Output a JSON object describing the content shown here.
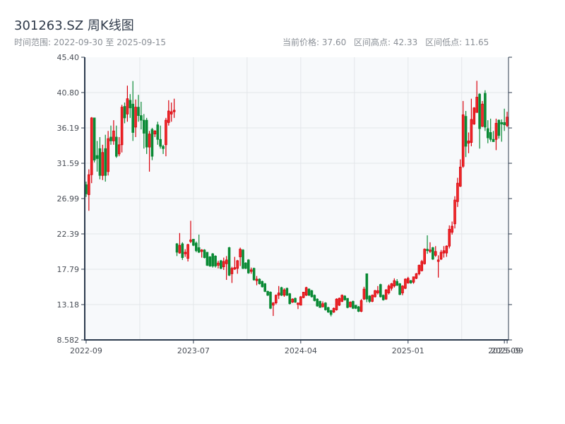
{
  "header": {
    "title": "301263.SZ 周K线图",
    "range_text": "时间范围: 2022-09-30 至 2025-09-15",
    "current_price": "当前价格: 37.60",
    "range_high": "区间高点: 42.33",
    "range_low": "区间低点: 11.65"
  },
  "colors": {
    "up": "#d9000b",
    "up_fill": "#ef2a2a",
    "down": "#0a8a35",
    "plot_bg": "#f7f9fb",
    "grid": "#e3e6ea",
    "axis": "#2d3b4e"
  },
  "chart_data": {
    "type": "candlestick",
    "title": "301263.SZ 周K线图",
    "ylim": [
      8.582,
      45.4
    ],
    "y_ticks": [
      "8.582",
      "13.18",
      "17.79",
      "22.39",
      "26.99",
      "31.59",
      "36.19",
      "40.80",
      "45.40"
    ],
    "x_ticks": [
      {
        "index": 0,
        "label": "2022-09"
      },
      {
        "index": 39,
        "label": "2023-07"
      },
      {
        "index": 78,
        "label": "2024-04"
      },
      {
        "index": 117,
        "label": "2025-01"
      },
      {
        "index": 152,
        "label": "2025-09"
      },
      {
        "index": 153,
        "label": "2025-09"
      }
    ],
    "grid": true,
    "ohlc_format": [
      "open",
      "close",
      "low",
      "high"
    ],
    "candles": [
      [
        28.8,
        27.6,
        27.2,
        29.2
      ],
      [
        27.5,
        30.1,
        25.4,
        30.8
      ],
      [
        30.1,
        37.5,
        29.0,
        37.6
      ],
      [
        37.5,
        32.0,
        31.7,
        37.5
      ],
      [
        32.6,
        32.2,
        30.5,
        34.5
      ],
      [
        33.5,
        30.0,
        29.5,
        35.0
      ],
      [
        30.0,
        33.0,
        29.4,
        34.0
      ],
      [
        33.5,
        30.0,
        29.2,
        35.3
      ],
      [
        30.5,
        34.8,
        30.0,
        35.8
      ],
      [
        35.0,
        34.5,
        34.0,
        36.5
      ],
      [
        34.5,
        35.8,
        34.0,
        37.2
      ],
      [
        35.0,
        32.5,
        32.3,
        36.5
      ],
      [
        32.8,
        34.0,
        32.5,
        35.0
      ],
      [
        34.0,
        38.9,
        33.0,
        39.2
      ],
      [
        39.0,
        37.5,
        36.8,
        39.5
      ],
      [
        38.0,
        40.0,
        37.0,
        41.7
      ],
      [
        39.8,
        38.8,
        37.5,
        40.6
      ],
      [
        39.3,
        35.6,
        34.5,
        42.3
      ],
      [
        36.3,
        38.9,
        35.0,
        39.9
      ],
      [
        38.9,
        37.8,
        37.0,
        40.5
      ],
      [
        37.8,
        37.2,
        36.0,
        39.6
      ],
      [
        37.2,
        35.5,
        33.5,
        38.0
      ],
      [
        37.2,
        33.7,
        32.8,
        37.5
      ],
      [
        33.7,
        35.4,
        30.5,
        35.8
      ],
      [
        36.0,
        32.5,
        32.0,
        36.2
      ],
      [
        35.4,
        35.8,
        35.0,
        35.9
      ],
      [
        36.6,
        34.7,
        34.0,
        37.0
      ],
      [
        34.7,
        33.8,
        33.5,
        36.5
      ],
      [
        33.8,
        33.5,
        32.8,
        34.0
      ],
      [
        34.0,
        37.2,
        32.5,
        37.5
      ],
      [
        36.9,
        38.4,
        36.5,
        39.8
      ],
      [
        38.0,
        38.3,
        37.0,
        39.5
      ],
      [
        38.3,
        38.5,
        37.5,
        40.0
      ],
      [
        21.1,
        20.0,
        19.5,
        21.2
      ],
      [
        19.9,
        20.9,
        19.8,
        22.5
      ],
      [
        21.1,
        19.3,
        19.0,
        21.3
      ],
      [
        19.8,
        20.0,
        19.4,
        20.4
      ],
      [
        19.2,
        21.0,
        18.8,
        21.1
      ],
      [
        21.4,
        21.6,
        21.2,
        24.1
      ],
      [
        21.7,
        20.9,
        20.8,
        21.7
      ],
      [
        21.2,
        20.2,
        20.0,
        21.4
      ],
      [
        20.6,
        20.0,
        19.9,
        22.3
      ],
      [
        20.1,
        20.3,
        19.3,
        20.4
      ],
      [
        20.3,
        19.3,
        19.2,
        20.4
      ],
      [
        20.0,
        18.3,
        18.2,
        20.0
      ],
      [
        19.4,
        18.2,
        18.1,
        19.5
      ],
      [
        19.8,
        18.2,
        18.0,
        19.9
      ],
      [
        19.5,
        18.2,
        18.0,
        19.6
      ],
      [
        18.3,
        18.6,
        17.9,
        18.9
      ],
      [
        18.9,
        17.9,
        17.8,
        19.0
      ],
      [
        18.1,
        18.8,
        17.7,
        19.3
      ],
      [
        18.5,
        19.0,
        16.4,
        19.5
      ],
      [
        20.6,
        17.0,
        16.9,
        20.7
      ],
      [
        17.2,
        17.9,
        16.0,
        18.1
      ],
      [
        17.8,
        18.0,
        17.7,
        19.4
      ],
      [
        17.9,
        18.9,
        17.2,
        19.0
      ],
      [
        19.4,
        20.4,
        18.2,
        20.6
      ],
      [
        20.3,
        17.9,
        17.8,
        20.4
      ],
      [
        18.6,
        17.9,
        17.8,
        18.7
      ],
      [
        19.0,
        17.3,
        17.2,
        19.1
      ],
      [
        17.5,
        17.7,
        17.2,
        18.0
      ],
      [
        17.9,
        16.4,
        16.3,
        18.0
      ],
      [
        16.3,
        16.5,
        15.7,
        16.9
      ],
      [
        16.5,
        15.9,
        15.8,
        16.6
      ],
      [
        16.2,
        15.5,
        15.4,
        16.3
      ],
      [
        15.9,
        14.9,
        14.8,
        16.0
      ],
      [
        14.9,
        14.4,
        14.3,
        15.0
      ],
      [
        14.8,
        12.7,
        12.6,
        14.9
      ],
      [
        13.1,
        13.4,
        11.7,
        13.5
      ],
      [
        13.4,
        14.4,
        13.2,
        14.5
      ],
      [
        14.4,
        14.7,
        13.9,
        15.6
      ],
      [
        15.4,
        14.4,
        14.3,
        15.5
      ],
      [
        14.4,
        15.1,
        14.2,
        15.3
      ],
      [
        15.3,
        14.4,
        14.3,
        15.4
      ],
      [
        14.6,
        13.3,
        13.2,
        14.7
      ],
      [
        13.5,
        13.9,
        13.4,
        14.0
      ],
      [
        14.0,
        13.5,
        13.4,
        14.1
      ],
      [
        13.2,
        13.4,
        12.6,
        13.4
      ],
      [
        13.1,
        14.2,
        13.1,
        14.3
      ],
      [
        14.1,
        14.8,
        14.0,
        14.8
      ],
      [
        14.4,
        15.4,
        14.3,
        15.5
      ],
      [
        15.2,
        14.4,
        14.3,
        15.3
      ],
      [
        15.0,
        14.2,
        14.1,
        15.1
      ],
      [
        14.4,
        13.7,
        13.6,
        14.5
      ],
      [
        13.9,
        13.0,
        12.9,
        14.0
      ],
      [
        13.6,
        12.8,
        12.8,
        13.7
      ],
      [
        12.9,
        13.3,
        12.8,
        13.6
      ],
      [
        13.4,
        12.5,
        12.4,
        13.5
      ],
      [
        12.8,
        12.2,
        12.1,
        12.9
      ],
      [
        12.4,
        11.9,
        11.65,
        12.5
      ],
      [
        12.2,
        12.7,
        12.1,
        12.8
      ],
      [
        12.5,
        13.9,
        12.4,
        14.0
      ],
      [
        13.1,
        14.0,
        13.0,
        14.1
      ],
      [
        13.6,
        14.4,
        13.5,
        14.5
      ],
      [
        14.3,
        13.8,
        13.7,
        14.4
      ],
      [
        14.0,
        12.8,
        12.7,
        14.0
      ],
      [
        12.9,
        13.5,
        12.8,
        13.6
      ],
      [
        13.6,
        12.7,
        12.6,
        13.7
      ],
      [
        13.1,
        12.7,
        12.6,
        13.1
      ],
      [
        12.9,
        12.3,
        12.2,
        13.0
      ],
      [
        12.3,
        13.7,
        12.2,
        13.9
      ],
      [
        13.9,
        15.2,
        13.8,
        15.5
      ],
      [
        17.2,
        13.9,
        13.5,
        17.2
      ],
      [
        14.3,
        13.6,
        13.4,
        14.4
      ],
      [
        13.6,
        14.4,
        13.5,
        14.5
      ],
      [
        14.2,
        15.0,
        14.1,
        15.1
      ],
      [
        14.7,
        15.0,
        14.5,
        15.6
      ],
      [
        15.8,
        14.2,
        14.1,
        15.9
      ],
      [
        14.4,
        13.8,
        13.7,
        14.5
      ],
      [
        13.9,
        15.1,
        13.8,
        15.2
      ],
      [
        14.7,
        15.6,
        14.5,
        15.8
      ],
      [
        15.3,
        15.9,
        15.0,
        16.0
      ],
      [
        15.6,
        16.3,
        15.4,
        16.6
      ],
      [
        16.2,
        15.7,
        15.6,
        16.5
      ],
      [
        15.9,
        14.5,
        14.4,
        16.0
      ],
      [
        14.7,
        15.6,
        14.4,
        15.7
      ],
      [
        15.3,
        16.5,
        15.2,
        16.6
      ],
      [
        16.0,
        16.6,
        15.9,
        16.8
      ],
      [
        16.3,
        16.0,
        15.9,
        16.4
      ],
      [
        16.1,
        16.8,
        15.9,
        16.8
      ],
      [
        16.6,
        17.2,
        16.5,
        17.3
      ],
      [
        17.2,
        18.3,
        17.0,
        18.4
      ],
      [
        17.6,
        18.8,
        17.5,
        19.0
      ],
      [
        18.5,
        20.4,
        18.4,
        20.5
      ],
      [
        20.4,
        20.2,
        19.8,
        22.2
      ],
      [
        20.1,
        20.3,
        19.9,
        21.3
      ],
      [
        20.6,
        19.1,
        19.0,
        20.7
      ],
      [
        19.6,
        20.1,
        19.4,
        20.8
      ],
      [
        18.8,
        19.0,
        16.7,
        19.6
      ],
      [
        19.1,
        20.0,
        19.0,
        20.3
      ],
      [
        19.9,
        20.2,
        19.3,
        20.8
      ],
      [
        19.9,
        20.8,
        19.4,
        20.9
      ],
      [
        20.8,
        23.0,
        20.5,
        23.5
      ],
      [
        22.6,
        23.4,
        22.3,
        24.0
      ],
      [
        23.7,
        26.8,
        23.1,
        27.3
      ],
      [
        26.6,
        29.0,
        25.9,
        29.7
      ],
      [
        28.6,
        31.1,
        28.5,
        32.1
      ],
      [
        31.2,
        37.9,
        31.0,
        39.7
      ],
      [
        37.7,
        33.8,
        32.4,
        38.4
      ],
      [
        34.2,
        34.5,
        32.9,
        35.6
      ],
      [
        34.3,
        37.3,
        33.8,
        40.0
      ],
      [
        36.7,
        38.8,
        36.6,
        38.9
      ],
      [
        38.2,
        40.2,
        38.2,
        42.33
      ],
      [
        40.6,
        36.1,
        33.5,
        40.7
      ],
      [
        36.4,
        39.3,
        36.3,
        39.7
      ],
      [
        40.7,
        36.3,
        35.8,
        41.1
      ],
      [
        36.1,
        34.9,
        34.2,
        37.2
      ],
      [
        35.6,
        34.7,
        34.4,
        37.4
      ],
      [
        34.7,
        34.4,
        34.4,
        35.8
      ],
      [
        34.7,
        36.8,
        33.3,
        37.4
      ],
      [
        37.2,
        35.2,
        34.8,
        37.3
      ],
      [
        36.9,
        36.7,
        34.4,
        37.3
      ],
      [
        36.9,
        36.6,
        35.8,
        38.7
      ],
      [
        36.5,
        37.6,
        36.3,
        38.3
      ]
    ]
  }
}
